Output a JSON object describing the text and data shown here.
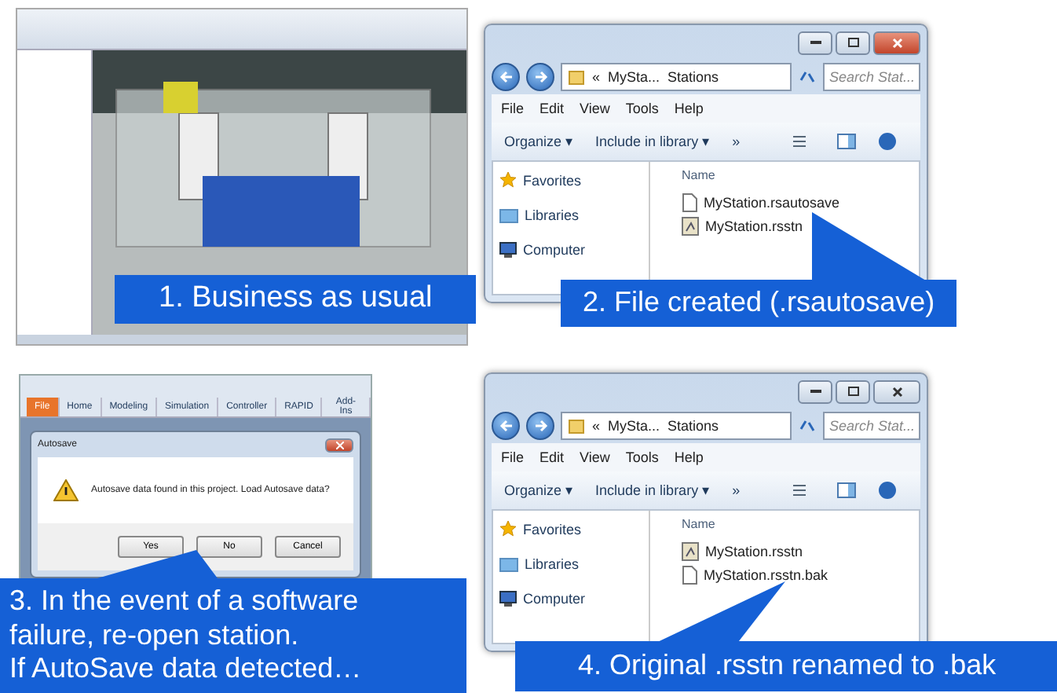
{
  "panels": [
    {
      "kind": "scene",
      "caption": "1. Business as usual"
    },
    {
      "kind": "explorer",
      "active": true,
      "path_prefix": "«",
      "path_root": "MySta...",
      "path_leaf": "Stations",
      "search_placeholder": "Search Stat...",
      "menu": [
        "File",
        "Edit",
        "View",
        "Tools",
        "Help"
      ],
      "organize": "Organize ▾",
      "include": "Include in library ▾",
      "more": "»",
      "nav": [
        "Favorites",
        "Libraries",
        "Computer"
      ],
      "column": "Name",
      "files": [
        {
          "name": "MyStation.rsautosave",
          "kind": "blank"
        },
        {
          "name": "MyStation.rsstn",
          "kind": "station"
        }
      ],
      "caption": "2. File created (.rsautosave)"
    },
    {
      "kind": "dialog",
      "ribbon_tabs": [
        {
          "label": "File",
          "selected": true
        },
        {
          "label": "Home",
          "selected": false
        },
        {
          "label": "Modeling",
          "selected": false
        },
        {
          "label": "Simulation",
          "selected": false
        },
        {
          "label": "Controller",
          "selected": false
        },
        {
          "label": "RAPID",
          "selected": false
        },
        {
          "label": "Add-Ins",
          "selected": false
        }
      ],
      "dialog_title": "Autosave",
      "message": "Autosave data found in this project. Load Autosave data?",
      "buttons": [
        "Yes",
        "No",
        "Cancel"
      ],
      "caption_lines": [
        "3. In the event of a software",
        "failure, re-open station.",
        "If AutoSave data detected…"
      ]
    },
    {
      "kind": "explorer",
      "active": false,
      "path_prefix": "«",
      "path_root": "MySta...",
      "path_leaf": "Stations",
      "search_placeholder": "Search Stat...",
      "menu": [
        "File",
        "Edit",
        "View",
        "Tools",
        "Help"
      ],
      "organize": "Organize ▾",
      "include": "Include in library ▾",
      "more": "»",
      "nav": [
        "Favorites",
        "Libraries",
        "Computer"
      ],
      "column": "Name",
      "files": [
        {
          "name": "MyStation.rsstn",
          "kind": "station"
        },
        {
          "name": "MyStation.rsstn.bak",
          "kind": "blank"
        }
      ],
      "caption": "4. Original .rsstn renamed to .bak"
    }
  ]
}
